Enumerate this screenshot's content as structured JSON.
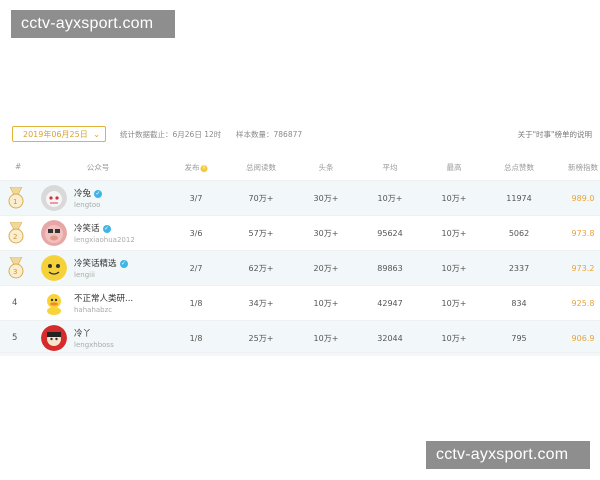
{
  "watermarks": {
    "top": "cctv-ayxsport.com",
    "bottom": "cctv-ayxsport.com"
  },
  "toolbar": {
    "date_value": "2019年06月25日",
    "deadline_text": "统计数据截止：6月26日 12时",
    "sample_text": "样本数量：786877",
    "explain_link": "关于\"时事\"榜单的说明"
  },
  "columns": {
    "rank": "#",
    "account": "公众号",
    "publish": "发布",
    "publish_badge": "Ⓓ",
    "total_reads": "总阅读数",
    "headline": "头条",
    "average": "平均",
    "max": "最高",
    "total_likes": "总点赞数",
    "index": "新榜指数"
  },
  "rows": [
    {
      "rank": "1",
      "medal": true,
      "name": "冷兔",
      "id": "lengtoo",
      "verified": true,
      "publish": "3/7",
      "total_reads": "70万+",
      "headline": "30万+",
      "average": "10万+",
      "max": "10万+",
      "total_likes": "11974",
      "index": "989.0",
      "avatar": "rabbit-avatar"
    },
    {
      "rank": "2",
      "medal": true,
      "name": "冷笑话",
      "id": "lengxiaohua2012",
      "verified": true,
      "publish": "3/6",
      "total_reads": "57万+",
      "headline": "30万+",
      "average": "95624",
      "max": "10万+",
      "total_likes": "5062",
      "index": "973.8",
      "avatar": "pig-avatar"
    },
    {
      "rank": "3",
      "medal": true,
      "name": "冷笑话精选",
      "id": "lengiii",
      "verified": true,
      "publish": "2/7",
      "total_reads": "62万+",
      "headline": "20万+",
      "average": "89863",
      "max": "10万+",
      "total_likes": "2337",
      "index": "973.2",
      "avatar": "yellow-face-avatar"
    },
    {
      "rank": "4",
      "medal": false,
      "name": "不正常人类研...",
      "id": "hahahabzc",
      "verified": false,
      "publish": "1/8",
      "total_reads": "34万+",
      "headline": "10万+",
      "average": "42947",
      "max": "10万+",
      "total_likes": "834",
      "index": "925.8",
      "avatar": "duck-avatar"
    },
    {
      "rank": "5",
      "medal": false,
      "name": "冷丫",
      "id": "lengxhboss",
      "verified": false,
      "publish": "1/8",
      "total_reads": "25万+",
      "headline": "10万+",
      "average": "32044",
      "max": "10万+",
      "total_likes": "795",
      "index": "906.9",
      "avatar": "red-hood-avatar"
    }
  ],
  "colors": {
    "accent": "#e3b23c",
    "score": "#e8a33a",
    "alt_row": "#f2f8f9",
    "verify": "#3fb4e5"
  }
}
